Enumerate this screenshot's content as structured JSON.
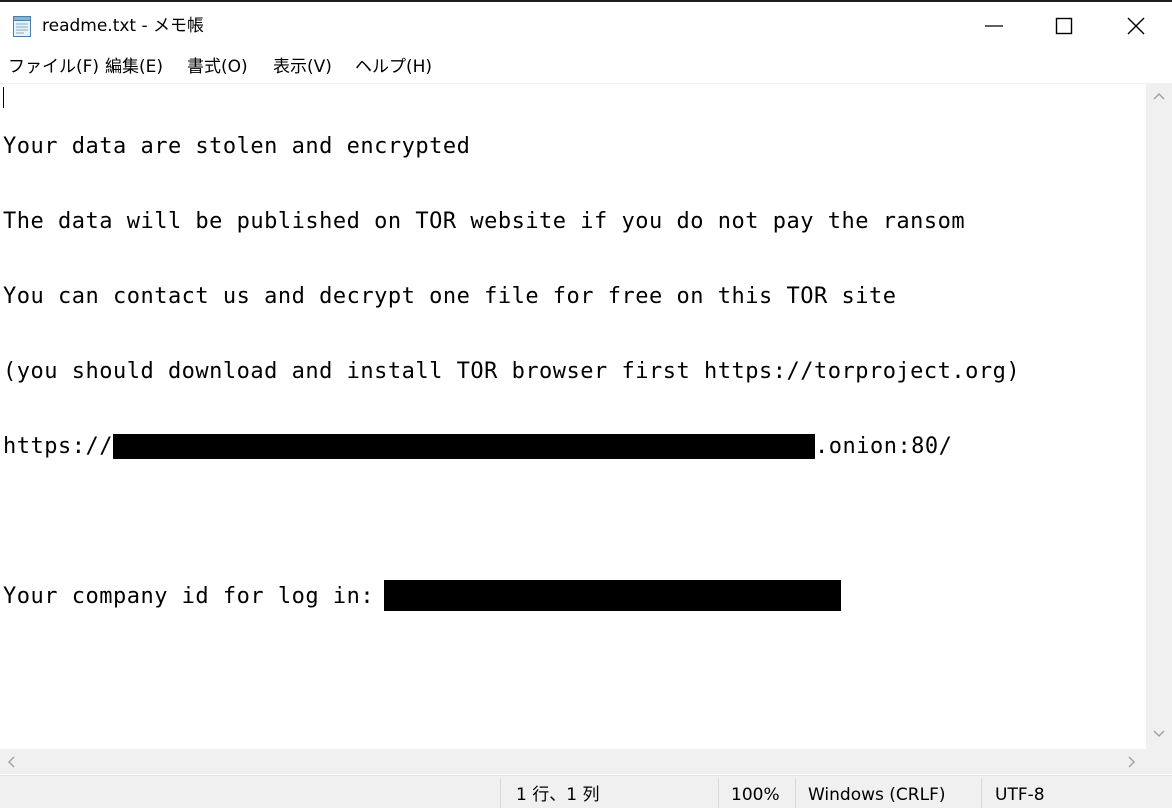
{
  "window": {
    "title": "readme.txt - メモ帳",
    "controls": {
      "minimize_icon": "minimize-icon",
      "maximize_icon": "maximize-icon",
      "close_icon": "close-icon"
    }
  },
  "menu": {
    "items": [
      "ファイル(F)",
      "編集(E)",
      "書式(O)",
      "表示(V)",
      "ヘルプ(H)"
    ]
  },
  "document": {
    "lines": [
      "Your data are stolen and encrypted",
      "The data will be published on TOR website if you do not pay the ransom",
      "You can contact us and decrypt one file for free on this TOR site",
      "(you should download and install TOR browser first https://torproject.org)"
    ],
    "url_prefix": "https://",
    "url_suffix": ".onion:80/",
    "company_id_label": "Your company id for log in: "
  },
  "status": {
    "position": "1 行、1 列",
    "zoom": "100%",
    "line_ending": "Windows (CRLF)",
    "encoding": "UTF-8"
  }
}
